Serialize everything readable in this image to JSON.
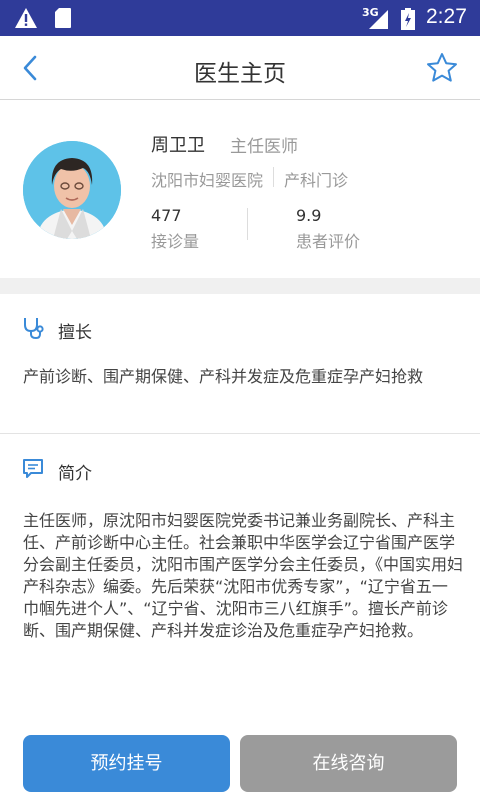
{
  "status_bar": {
    "network": "3G",
    "time": "2:27"
  },
  "nav": {
    "title": "医生主页"
  },
  "doctor": {
    "name": "周卫卫",
    "title": "主任医师",
    "hospital": "沈阳市妇婴医院",
    "department": "产科门诊",
    "stats": [
      {
        "value": "477",
        "label": "接诊量"
      },
      {
        "value": "9.9",
        "label": "患者评价"
      }
    ]
  },
  "specialty": {
    "heading": "擅长",
    "text": "产前诊断、围产期保健、产科并发症及危重症孕产妇抢救"
  },
  "intro": {
    "heading": "简介",
    "text": "主任医师，原沈阳市妇婴医院党委书记兼业务副院长、产科主任、产前诊断中心主任。社会兼职中华医学会辽宁省围产医学分会副主任委员，沈阳市围产医学分会主任委员，《中国实用妇产科杂志》编委。先后荣获“沈阳市优秀专家”，“辽宁省五一巾帼先进个人”、“辽宁省、沈阳市三八红旗手”。擅长产前诊断、围产期保健、产科并发症诊治及危重症孕产妇抢救。"
  },
  "actions": {
    "book": "预约挂号",
    "consult": "在线咨询"
  },
  "colors": {
    "status_bar": "#2f3b99",
    "accent": "#3a8ad8",
    "disabled_button": "#9b9b9b"
  }
}
